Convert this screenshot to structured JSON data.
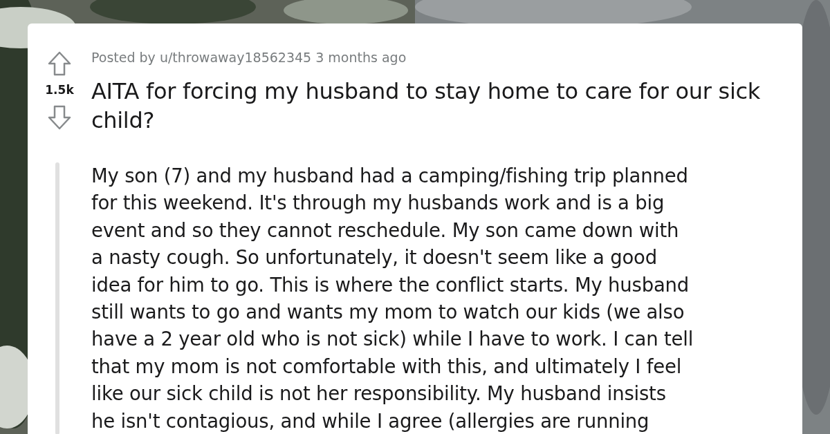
{
  "post": {
    "votes": "1.5k",
    "posted_by": "Posted by u/throwaway18562345 3 months ago",
    "title": "AITA for forcing my husband to stay home to care for our sick child?",
    "body_lines": [
      "My son (7) and my husband had a camping/fishing trip planned",
      "for this weekend. It's through my husbands work and is a big",
      "event and so they cannot reschedule. My son came down with",
      "a nasty cough. So unfortunately, it doesn't seem like a good",
      "idea for him to go. This is where the conflict starts. My husband",
      "still wants to go and wants my mom to watch our kids (we also",
      "have a 2 year old who is not sick) while I have to work. I can tell",
      "that my mom is not comfortable with this, and ultimately I feel",
      "like our sick child is not her responsibility. My husband insists",
      "he isn't contagious, and while I agree (allergies are running"
    ]
  }
}
